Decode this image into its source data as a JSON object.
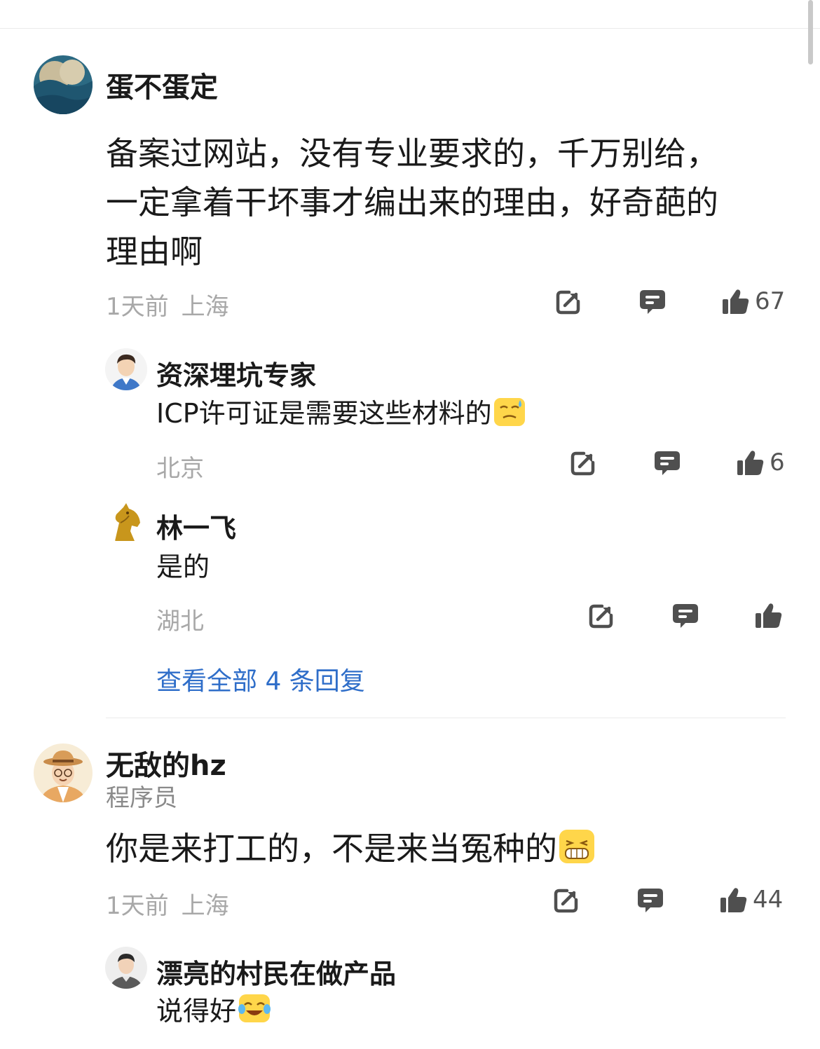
{
  "colors": {
    "link": "#2f6ec9",
    "meta": "#a8a8a8",
    "icon": "#4f4f4f"
  },
  "comments": [
    {
      "user": "蛋不蛋定",
      "text_lines": [
        "备案过网站，没有专业要求的，千万别给，",
        "一定拿着干坏事才编出来的理由，好奇葩的",
        "理由啊"
      ],
      "time": "1天前",
      "location": "上海",
      "likes": "67",
      "icons": [
        "share-icon",
        "reply-icon",
        "thumbs-up-icon"
      ],
      "replies": [
        {
          "user": "资深埋坑专家",
          "text": "ICP许可证是需要这些材料的",
          "emoji": "sweat-smile-emoji",
          "location": "北京",
          "likes": "6"
        },
        {
          "user": "林一飞",
          "text": "是的",
          "location": "湖北",
          "likes": ""
        }
      ],
      "view_all": "查看全部 4 条回复"
    },
    {
      "user": "无敌的hz",
      "title": "程序员",
      "text": "你是来打工的，不是来当冤种的",
      "emoji": "grin-emoji",
      "time": "1天前",
      "location": "上海",
      "likes": "44",
      "replies": [
        {
          "user": "漂亮的村民在做产品",
          "text": "说得好",
          "emoji": "tears-of-joy-emoji"
        }
      ]
    }
  ]
}
